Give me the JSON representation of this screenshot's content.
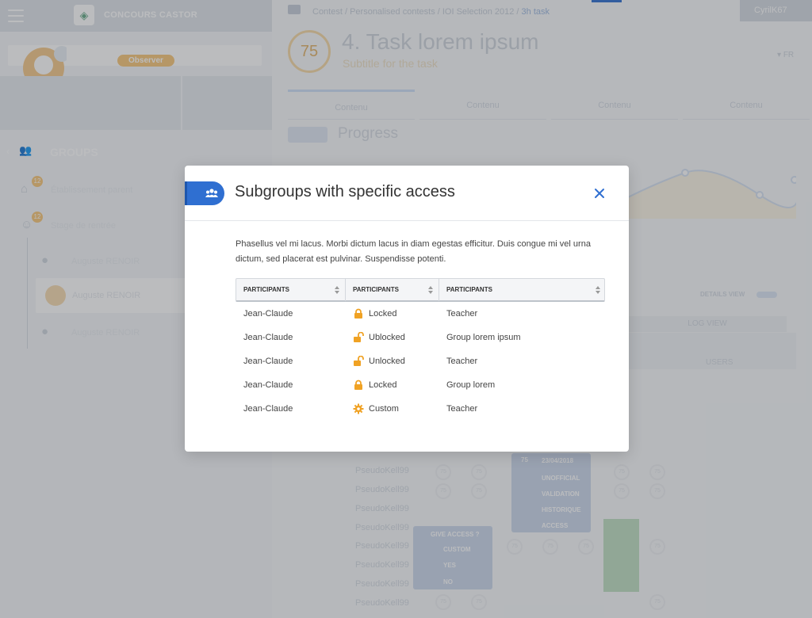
{
  "app": {
    "title": "CONCOURS CASTOR",
    "user": "CyrilK67",
    "role_badge": "Observer"
  },
  "sidebar": {
    "section_label": "GROUPS",
    "items": [
      {
        "label": "Établissement parent",
        "badge": "12"
      },
      {
        "label": "Stage de rentrée",
        "badge": "12"
      },
      {
        "label": "Auguste RENOIR"
      },
      {
        "label": "Auguste RENOIR"
      },
      {
        "label": "Auguste RENOIR"
      }
    ]
  },
  "breadcrumb": {
    "parts": "Contest / Personalised contests / IOI Selection 2012 / ",
    "current": "3h task"
  },
  "task": {
    "score": "75",
    "title": "4. Task lorem ipsum",
    "subtitle": "Subtitle for the task",
    "lang": "FR",
    "tabs": [
      "Contenu",
      "Contenu",
      "Contenu",
      "Contenu"
    ],
    "progress_label": "Progress"
  },
  "background": {
    "details_view": "DETAILS VIEW",
    "log_view": "LOG VIEW",
    "users": "USERS",
    "pseudo": "PseudoKell99",
    "cell_score": "75",
    "popup_date": "23/04/2018",
    "popup_items": [
      "UNOFFICIAL",
      "VALIDATION",
      "HISTORIQUE",
      "ACCESS"
    ],
    "give_access": "GIVE ACCESS ?",
    "give_items": [
      "CUSTOM",
      "YES",
      "NO"
    ]
  },
  "modal": {
    "title": "Subgroups with specific access",
    "description": "Phasellus vel mi lacus. Morbi dictum lacus in diam egestas efficitur. Duis congue mi vel urna dictum, sed placerat est pulvinar. Suspendisse potenti.",
    "columns": [
      "PARTICIPANTS",
      "PARTICIPANTS",
      "PARTICIPANTS"
    ],
    "rows": [
      {
        "name": "Jean-Claude",
        "icon": "lock-icon",
        "status": "Locked",
        "group": "Teacher"
      },
      {
        "name": "Jean-Claude",
        "icon": "unlock-icon",
        "status": "Ublocked",
        "group": "Group lorem ipsum"
      },
      {
        "name": "Jean-Claude",
        "icon": "unlock-icon",
        "status": "Unlocked",
        "group": "Teacher"
      },
      {
        "name": "Jean-Claude",
        "icon": "lock-icon",
        "status": "Locked",
        "group": "Group lorem"
      },
      {
        "name": "Jean-Claude",
        "icon": "gear-icon",
        "status": "Custom",
        "group": "Teacher"
      }
    ],
    "accent_color": "#2f6fd1",
    "status_icon_color": "#f0a224"
  }
}
